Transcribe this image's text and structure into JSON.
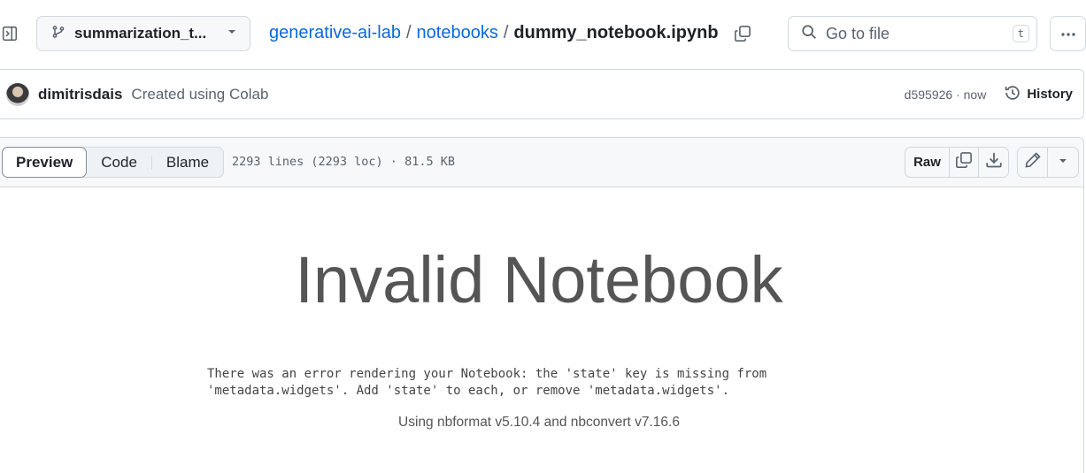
{
  "header": {
    "branch": "summarization_t...",
    "breadcrumb": {
      "repo": "generative-ai-lab",
      "separator": "/",
      "folder": "notebooks",
      "file": "dummy_notebook.ipynb"
    },
    "search": {
      "placeholder": "Go to file",
      "shortcut": "t"
    }
  },
  "commit": {
    "author": "dimitrisdais",
    "message": "Created using Colab",
    "sha_time": "d595926 · now",
    "history_label": "History"
  },
  "file_header": {
    "tabs": [
      {
        "label": "Preview",
        "active": true
      },
      {
        "label": "Code",
        "active": false
      },
      {
        "label": "Blame",
        "active": false
      }
    ],
    "info": "2293 lines (2293 loc) · 81.5 KB",
    "raw_label": "Raw"
  },
  "content": {
    "title": "Invalid Notebook",
    "error": "There was an error rendering your Notebook: the 'state' key is missing from\n'metadata.widgets'. Add 'state' to each, or remove 'metadata.widgets'.",
    "versions": "Using nbformat v5.10.4 and nbconvert v7.16.6"
  },
  "colors": {
    "link": "#0969da",
    "border": "#d1d9e0",
    "muted": "#59636e"
  }
}
